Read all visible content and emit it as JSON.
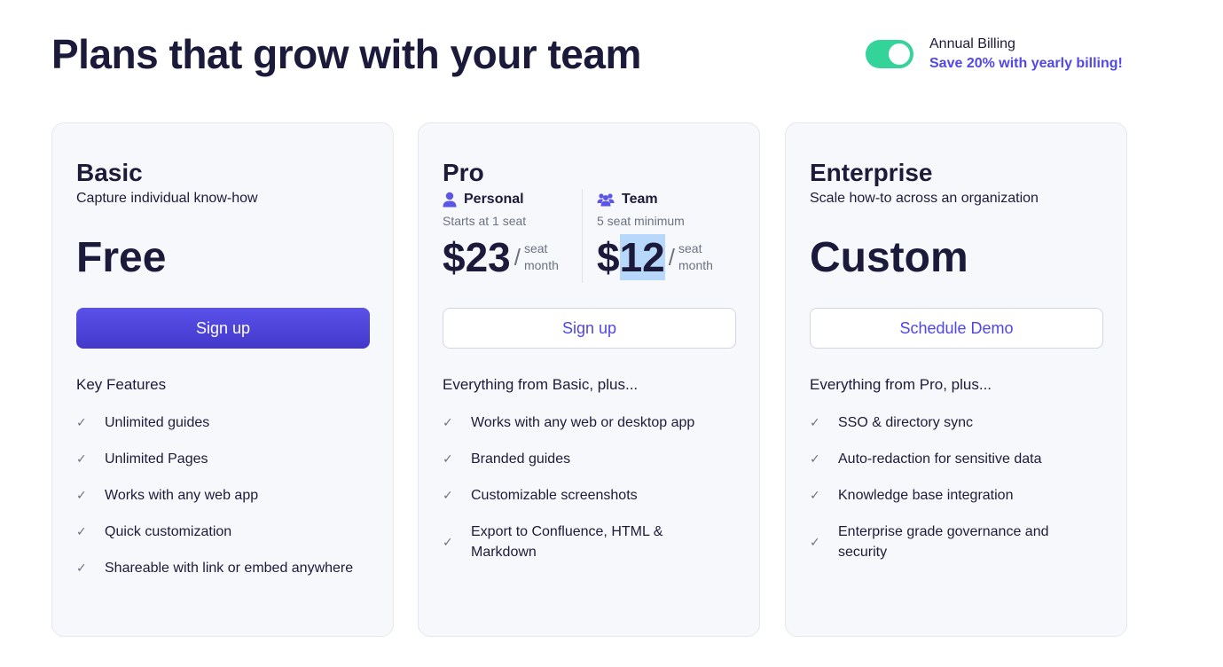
{
  "header": {
    "title": "Plans that grow with your team",
    "billing_label": "Annual Billing",
    "billing_sub": "Save 20% with yearly billing!",
    "billing_toggle_on": true,
    "toggle_color": "#34d399",
    "accent_color": "#4f46e5"
  },
  "basic": {
    "name": "Basic",
    "desc": "Capture individual know-how",
    "price": "Free",
    "button": "Sign up",
    "features_heading": "Key Features",
    "features": [
      "Unlimited guides",
      "Unlimited Pages",
      "Works with any web app",
      "Quick customization",
      "Shareable with link or embed anywhere"
    ]
  },
  "pro": {
    "name": "Pro",
    "personal": {
      "label": "Personal",
      "sub": "Starts at 1 seat",
      "price": "$23",
      "per_top": "seat",
      "per_bottom": "month"
    },
    "team": {
      "label": "Team",
      "sub": "5 seat minimum",
      "price_prefix": "$",
      "price_selected": "12",
      "per_top": "seat",
      "per_bottom": "month"
    },
    "slash": "/",
    "button": "Sign up",
    "features_heading": "Everything from Basic, plus...",
    "features": [
      "Works with any web or desktop app",
      "Branded guides",
      "Customizable screenshots",
      "Export to Confluence, HTML & Markdown"
    ]
  },
  "enterprise": {
    "name": "Enterprise",
    "desc": "Scale how-to across an organization",
    "price": "Custom",
    "button": "Schedule Demo",
    "features_heading": "Everything from Pro, plus...",
    "features": [
      "SSO & directory sync",
      "Auto-redaction for sensitive data",
      "Knowledge base integration",
      "Enterprise grade governance and security"
    ]
  }
}
